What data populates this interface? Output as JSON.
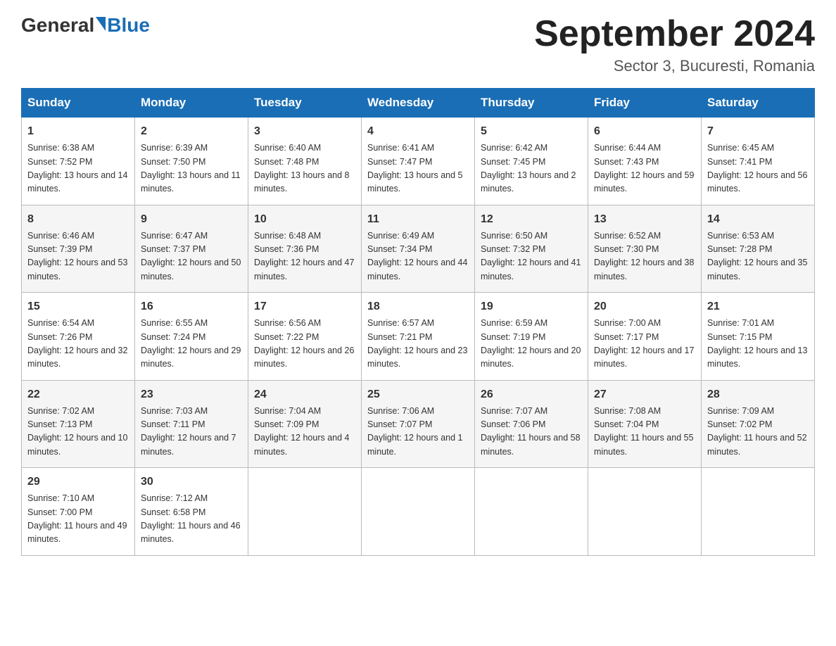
{
  "logo": {
    "general": "General",
    "blue": "Blue"
  },
  "title": "September 2024",
  "location": "Sector 3, Bucuresti, Romania",
  "days_of_week": [
    "Sunday",
    "Monday",
    "Tuesday",
    "Wednesday",
    "Thursday",
    "Friday",
    "Saturday"
  ],
  "weeks": [
    [
      {
        "day": "1",
        "sunrise": "6:38 AM",
        "sunset": "7:52 PM",
        "daylight": "13 hours and 14 minutes."
      },
      {
        "day": "2",
        "sunrise": "6:39 AM",
        "sunset": "7:50 PM",
        "daylight": "13 hours and 11 minutes."
      },
      {
        "day": "3",
        "sunrise": "6:40 AM",
        "sunset": "7:48 PM",
        "daylight": "13 hours and 8 minutes."
      },
      {
        "day": "4",
        "sunrise": "6:41 AM",
        "sunset": "7:47 PM",
        "daylight": "13 hours and 5 minutes."
      },
      {
        "day": "5",
        "sunrise": "6:42 AM",
        "sunset": "7:45 PM",
        "daylight": "13 hours and 2 minutes."
      },
      {
        "day": "6",
        "sunrise": "6:44 AM",
        "sunset": "7:43 PM",
        "daylight": "12 hours and 59 minutes."
      },
      {
        "day": "7",
        "sunrise": "6:45 AM",
        "sunset": "7:41 PM",
        "daylight": "12 hours and 56 minutes."
      }
    ],
    [
      {
        "day": "8",
        "sunrise": "6:46 AM",
        "sunset": "7:39 PM",
        "daylight": "12 hours and 53 minutes."
      },
      {
        "day": "9",
        "sunrise": "6:47 AM",
        "sunset": "7:37 PM",
        "daylight": "12 hours and 50 minutes."
      },
      {
        "day": "10",
        "sunrise": "6:48 AM",
        "sunset": "7:36 PM",
        "daylight": "12 hours and 47 minutes."
      },
      {
        "day": "11",
        "sunrise": "6:49 AM",
        "sunset": "7:34 PM",
        "daylight": "12 hours and 44 minutes."
      },
      {
        "day": "12",
        "sunrise": "6:50 AM",
        "sunset": "7:32 PM",
        "daylight": "12 hours and 41 minutes."
      },
      {
        "day": "13",
        "sunrise": "6:52 AM",
        "sunset": "7:30 PM",
        "daylight": "12 hours and 38 minutes."
      },
      {
        "day": "14",
        "sunrise": "6:53 AM",
        "sunset": "7:28 PM",
        "daylight": "12 hours and 35 minutes."
      }
    ],
    [
      {
        "day": "15",
        "sunrise": "6:54 AM",
        "sunset": "7:26 PM",
        "daylight": "12 hours and 32 minutes."
      },
      {
        "day": "16",
        "sunrise": "6:55 AM",
        "sunset": "7:24 PM",
        "daylight": "12 hours and 29 minutes."
      },
      {
        "day": "17",
        "sunrise": "6:56 AM",
        "sunset": "7:22 PM",
        "daylight": "12 hours and 26 minutes."
      },
      {
        "day": "18",
        "sunrise": "6:57 AM",
        "sunset": "7:21 PM",
        "daylight": "12 hours and 23 minutes."
      },
      {
        "day": "19",
        "sunrise": "6:59 AM",
        "sunset": "7:19 PM",
        "daylight": "12 hours and 20 minutes."
      },
      {
        "day": "20",
        "sunrise": "7:00 AM",
        "sunset": "7:17 PM",
        "daylight": "12 hours and 17 minutes."
      },
      {
        "day": "21",
        "sunrise": "7:01 AM",
        "sunset": "7:15 PM",
        "daylight": "12 hours and 13 minutes."
      }
    ],
    [
      {
        "day": "22",
        "sunrise": "7:02 AM",
        "sunset": "7:13 PM",
        "daylight": "12 hours and 10 minutes."
      },
      {
        "day": "23",
        "sunrise": "7:03 AM",
        "sunset": "7:11 PM",
        "daylight": "12 hours and 7 minutes."
      },
      {
        "day": "24",
        "sunrise": "7:04 AM",
        "sunset": "7:09 PM",
        "daylight": "12 hours and 4 minutes."
      },
      {
        "day": "25",
        "sunrise": "7:06 AM",
        "sunset": "7:07 PM",
        "daylight": "12 hours and 1 minute."
      },
      {
        "day": "26",
        "sunrise": "7:07 AM",
        "sunset": "7:06 PM",
        "daylight": "11 hours and 58 minutes."
      },
      {
        "day": "27",
        "sunrise": "7:08 AM",
        "sunset": "7:04 PM",
        "daylight": "11 hours and 55 minutes."
      },
      {
        "day": "28",
        "sunrise": "7:09 AM",
        "sunset": "7:02 PM",
        "daylight": "11 hours and 52 minutes."
      }
    ],
    [
      {
        "day": "29",
        "sunrise": "7:10 AM",
        "sunset": "7:00 PM",
        "daylight": "11 hours and 49 minutes."
      },
      {
        "day": "30",
        "sunrise": "7:12 AM",
        "sunset": "6:58 PM",
        "daylight": "11 hours and 46 minutes."
      },
      null,
      null,
      null,
      null,
      null
    ]
  ]
}
